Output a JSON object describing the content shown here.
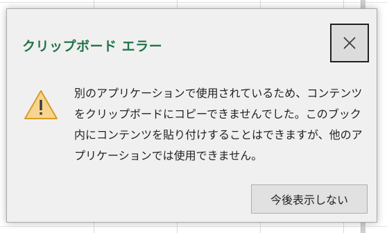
{
  "dialog": {
    "title": "クリップボード エラー",
    "close_icon": "close-icon",
    "warning_icon": "warning-icon",
    "message": "別のアプリケーションで使用されているため、コンテンツをクリップボードにコピーできませんでした。このブック内にコンテンツを貼り付けすることはできますが、他のアプリケーションでは使用できません。",
    "dont_show_again_label": "今後表示しない"
  },
  "colors": {
    "title": "#217346",
    "warning_fill": "#f7d58e",
    "warning_stroke": "#d79b2b",
    "dialog_bg": "#f0f0f0"
  }
}
